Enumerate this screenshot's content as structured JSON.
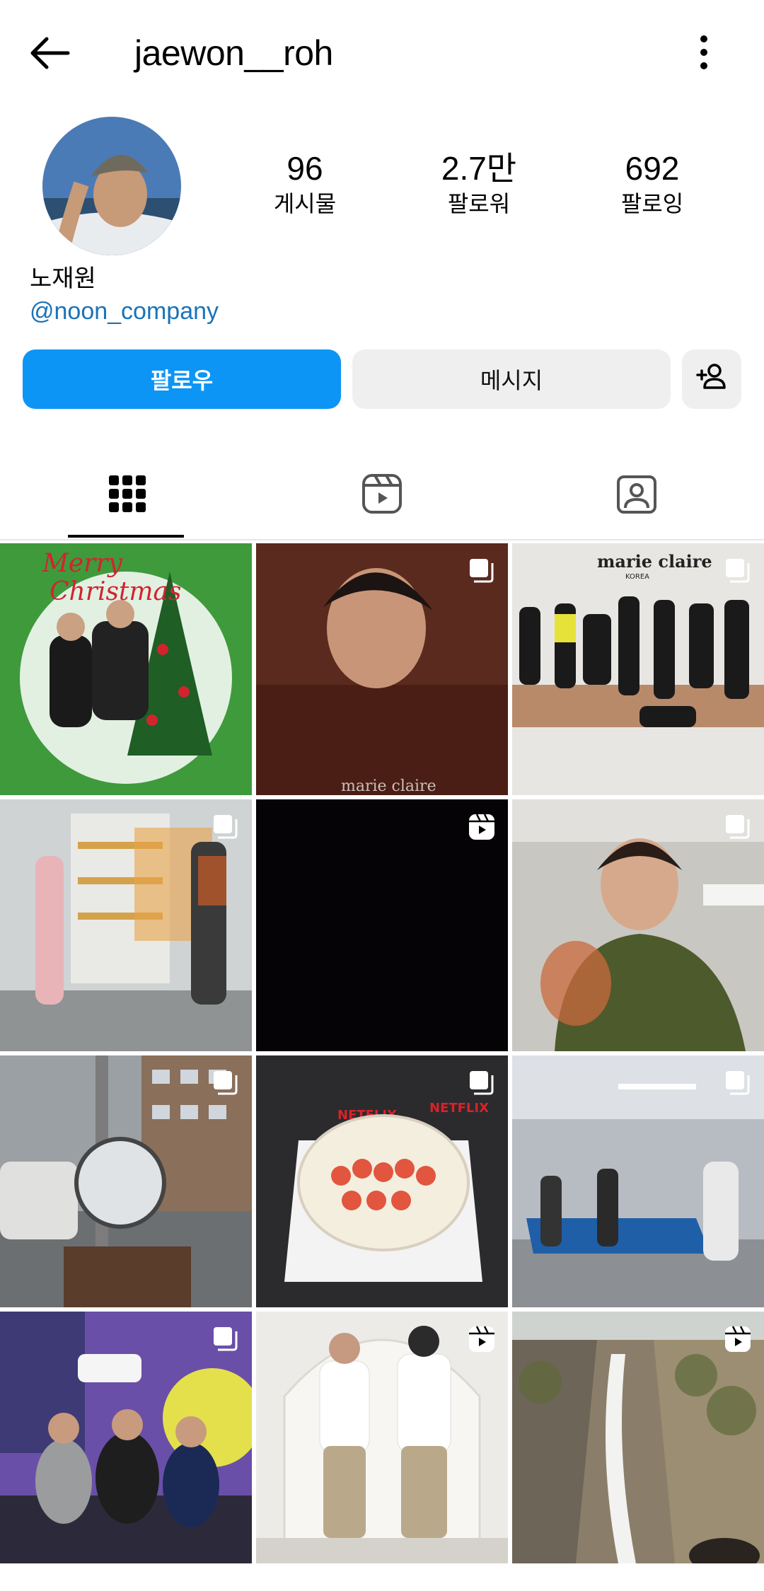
{
  "header": {
    "username": "jaewon__roh"
  },
  "profile": {
    "name": "노재원",
    "link": "@noon_company",
    "stats": [
      {
        "value": "96",
        "label": "게시물"
      },
      {
        "value": "2.7만",
        "label": "팔로워"
      },
      {
        "value": "692",
        "label": "팔로잉"
      }
    ]
  },
  "actions": {
    "follow": "팔로우",
    "message": "메시지"
  },
  "tabs": [
    {
      "icon": "grid-icon",
      "selected": true
    },
    {
      "icon": "reels-icon",
      "selected": false
    },
    {
      "icon": "tagged-icon",
      "selected": false
    }
  ],
  "posts": [
    {
      "type": "photo",
      "caption_art": "Merry Christmas",
      "badge": null
    },
    {
      "type": "carousel",
      "caption_art": "marie claire",
      "badge": "carousel-icon"
    },
    {
      "type": "carousel",
      "caption_art": "marie claire KOREA",
      "badge": "carousel-icon"
    },
    {
      "type": "carousel",
      "badge": "carousel-icon"
    },
    {
      "type": "reel",
      "badge": "reel-icon"
    },
    {
      "type": "carousel",
      "badge": "carousel-icon"
    },
    {
      "type": "carousel",
      "badge": "carousel-icon"
    },
    {
      "type": "carousel",
      "caption_art": "NETFLIX",
      "badge": "carousel-icon"
    },
    {
      "type": "carousel",
      "badge": "carousel-icon"
    },
    {
      "type": "carousel",
      "badge": "carousel-icon"
    },
    {
      "type": "reel",
      "badge": "reel-icon"
    },
    {
      "type": "reel",
      "badge": "reel-icon"
    }
  ],
  "colors": {
    "follow_button": "#0d95f5",
    "link": "#1a73b8",
    "secondary_button": "#efefef"
  }
}
